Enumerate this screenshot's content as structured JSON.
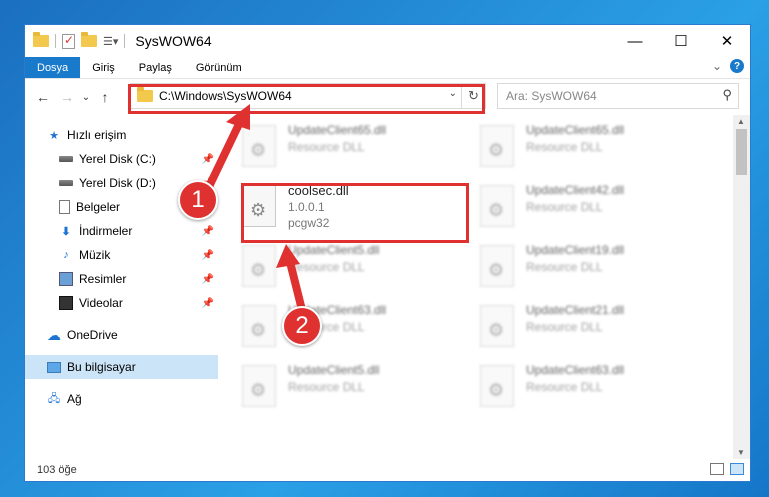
{
  "window": {
    "title": "SysWOW64",
    "minimize": "—",
    "maximize": "☐",
    "close": "✕"
  },
  "ribbon": {
    "tabs": [
      "Dosya",
      "Giriş",
      "Paylaş",
      "Görünüm"
    ],
    "expand": "⌄",
    "help": "?"
  },
  "nav": {
    "back": "←",
    "forward": "→",
    "recent": "⌄",
    "up": "↑"
  },
  "address": {
    "path": "C:\\Windows\\SysWOW64",
    "dropdown": "⌄",
    "refresh": "↻"
  },
  "search": {
    "placeholder": "Ara: SysWOW64",
    "icon": "⚲"
  },
  "sidebar": {
    "quick_access": "Hızlı erişim",
    "items": [
      {
        "label": "Yerel Disk (C:)",
        "icon": "disk-icon"
      },
      {
        "label": "Yerel Disk (D:)",
        "icon": "disk-icon"
      },
      {
        "label": "Belgeler",
        "icon": "document-icon"
      },
      {
        "label": "İndirmeler",
        "icon": "download-icon"
      },
      {
        "label": "Müzik",
        "icon": "music-icon"
      },
      {
        "label": "Resimler",
        "icon": "pictures-icon"
      },
      {
        "label": "Videolar",
        "icon": "videos-icon"
      }
    ],
    "onedrive": "OneDrive",
    "this_pc": "Bu bilgisayar",
    "network": "Ağ",
    "pin": "📌"
  },
  "files": {
    "left": [
      {
        "name": "UpdateClient65.dll",
        "meta": "Resource DLL"
      },
      {
        "name": "coolsec.dll",
        "meta": "1.0.0.1",
        "meta2": "pcgw32"
      },
      {
        "name": "UpdateClient5.dll",
        "meta": "Resource DLL"
      },
      {
        "name": "UpdateClient63.dll",
        "meta": "Resource DLL"
      },
      {
        "name": "UpdateClient5.dll",
        "meta": "Resource DLL"
      }
    ],
    "right": [
      {
        "name": "UpdateClient65.dll",
        "meta": "Resource DLL"
      },
      {
        "name": "UpdateClient42.dll",
        "meta": "Resource DLL"
      },
      {
        "name": "UpdateClient19.dll",
        "meta": "Resource DLL"
      },
      {
        "name": "UpdateClient21.dll",
        "meta": "Resource DLL"
      },
      {
        "name": "UpdateClient63.dll",
        "meta": "Resource DLL"
      }
    ]
  },
  "status": {
    "count": "103 öğe"
  },
  "callouts": {
    "one": "1",
    "two": "2"
  },
  "colors": {
    "accent": "#1979ca",
    "highlight": "#e03131"
  }
}
